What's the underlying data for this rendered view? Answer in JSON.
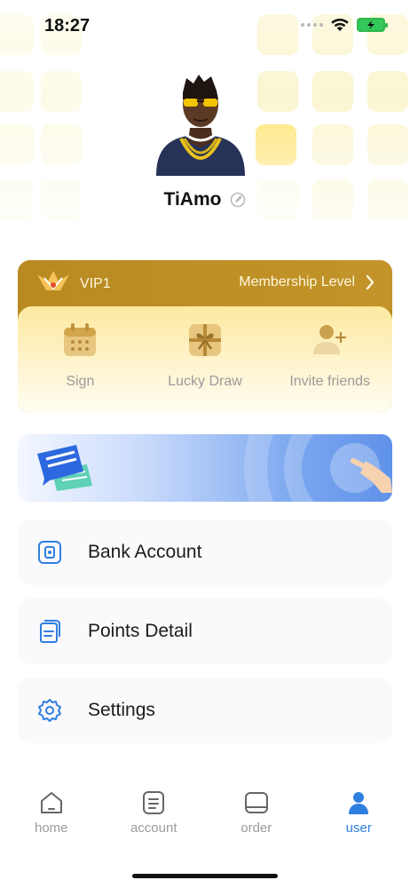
{
  "status_bar": {
    "time": "18:27"
  },
  "profile": {
    "username": "TiAmo"
  },
  "vip": {
    "level": "VIP1",
    "link_label": "Membership Level",
    "actions": [
      {
        "label": "Sign",
        "icon": "calendar-icon"
      },
      {
        "label": "Lucky Draw",
        "icon": "gift-icon"
      },
      {
        "label": "Invite friends",
        "icon": "add-user-icon"
      }
    ]
  },
  "menu": [
    {
      "label": "Bank Account",
      "icon": "bank-card-icon"
    },
    {
      "label": "Points Detail",
      "icon": "document-icon"
    },
    {
      "label": "Settings",
      "icon": "gear-icon"
    }
  ],
  "tabs": [
    {
      "label": "home",
      "icon": "home-icon",
      "active": false
    },
    {
      "label": "account",
      "icon": "account-icon",
      "active": false
    },
    {
      "label": "order",
      "icon": "order-icon",
      "active": false
    },
    {
      "label": "user",
      "icon": "user-icon",
      "active": true
    }
  ],
  "colors": {
    "accent": "#2f7fe0",
    "vip_gold": "#b98a1f",
    "highlight_tile": "#ffe57a"
  }
}
